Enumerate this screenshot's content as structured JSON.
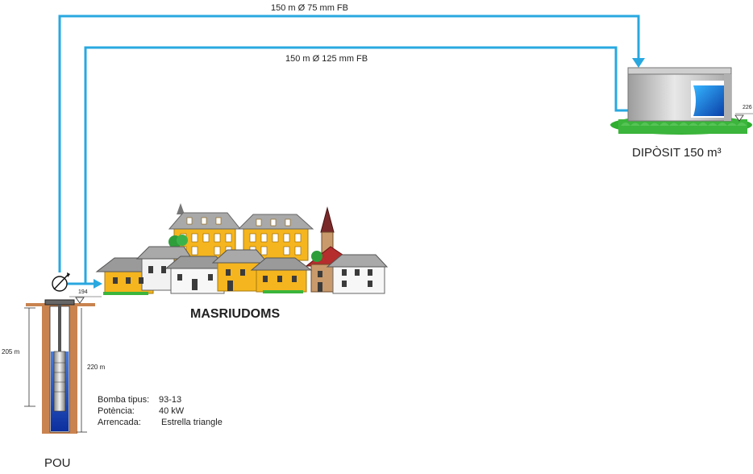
{
  "pipes": {
    "upper": "150 m Ø 75 mm FB",
    "lower": "150 m Ø 125 mm FB"
  },
  "tank": {
    "label": "DIPÒSIT 150 m³",
    "level": "226"
  },
  "town": {
    "label": "MASRIUDOMS"
  },
  "well": {
    "label": "POU",
    "level": "194",
    "depth_left": "205 m",
    "depth_right": "220 m",
    "pump_specs": [
      {
        "key": "Bomba tipus:",
        "value": "93-13"
      },
      {
        "key": "Potència:",
        "value": "40 kW"
      },
      {
        "key": "Arrencada:",
        "value": "Estrella triangle"
      }
    ]
  },
  "colors": {
    "pipe": "#29a8e0",
    "water": "#1a5bc4",
    "grass": "#3bb53b",
    "house_yellow": "#f5b51e",
    "roof_gray": "#9a9a9a",
    "soil": "#c9834f"
  },
  "icons": [
    "flow-meter-icon",
    "level-triangle-icon",
    "submersible-pump-icon"
  ]
}
